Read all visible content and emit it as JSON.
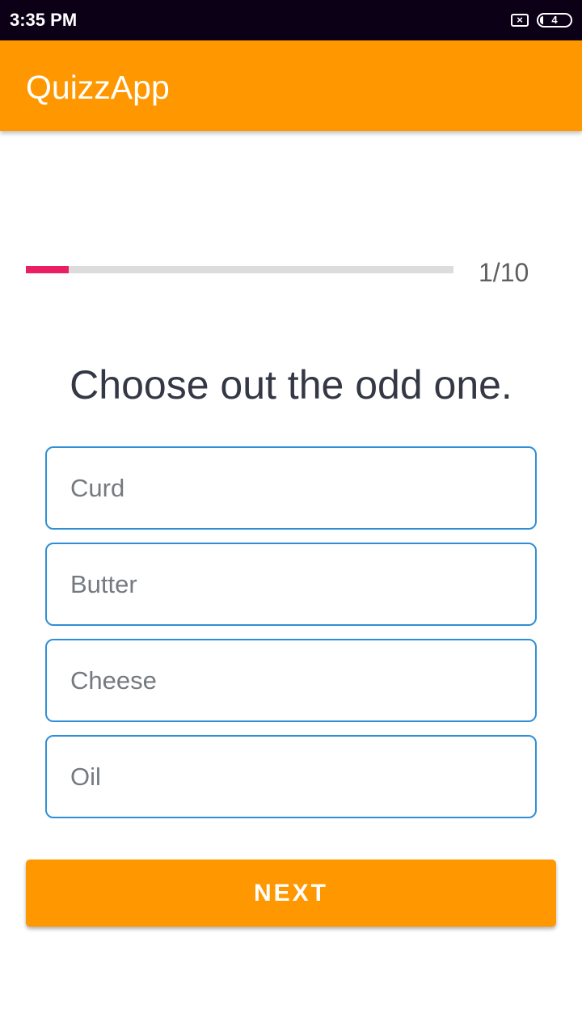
{
  "status_bar": {
    "time": "3:35 PM",
    "sim_icon": "sim-x-icon",
    "sim_glyph": "×",
    "battery_icon": "battery-icon",
    "battery_level": "4"
  },
  "app_bar": {
    "title": "QuizzApp",
    "color": "#ff9800"
  },
  "progress": {
    "current": 1,
    "total": 10,
    "fraction": 0.1,
    "text": "1/10",
    "fill_color": "#e91e63",
    "track_color": "#dcdcdc"
  },
  "question": {
    "text": "Choose out the odd one."
  },
  "options": [
    {
      "label": "Curd"
    },
    {
      "label": "Butter"
    },
    {
      "label": "Cheese"
    },
    {
      "label": "Oil"
    }
  ],
  "option_border_color": "#2f8fd6",
  "next_button": {
    "label": "NEXT",
    "color": "#ff9800"
  }
}
